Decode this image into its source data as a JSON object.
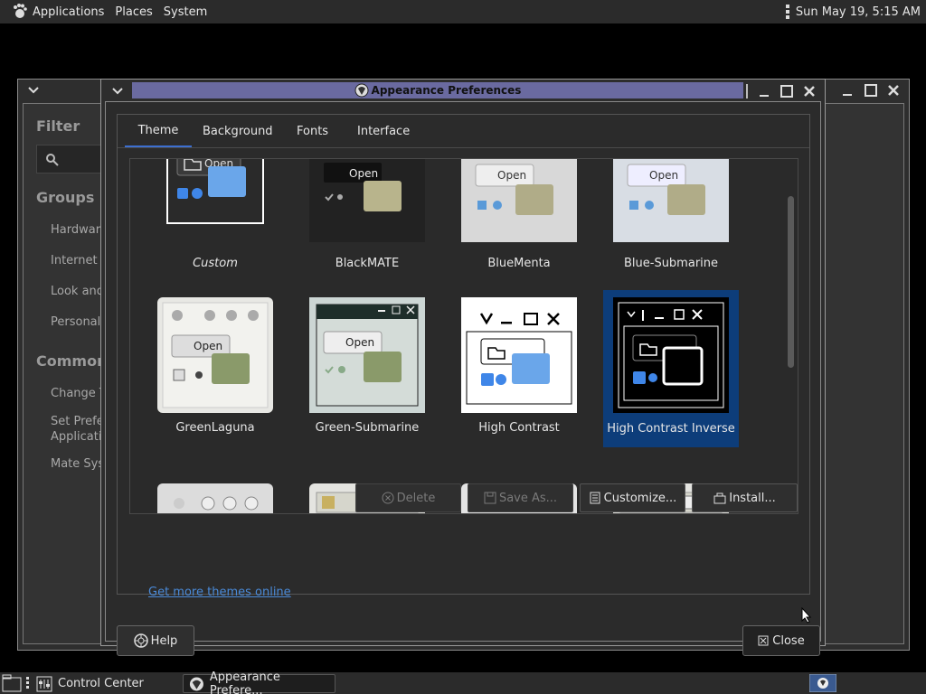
{
  "top_panel": {
    "menus": [
      "Applications",
      "Places",
      "System"
    ],
    "clock": "Sun May 19,  5:15 AM"
  },
  "control_center": {
    "filter_heading": "Filter",
    "groups_heading": "Groups",
    "groups": [
      "Hardware",
      "Internet a",
      "Look and",
      "Personal"
    ],
    "common_heading": "Common T",
    "common_items": [
      "Change T",
      "Set Prefe",
      "Applicatio",
      "Mate Syst"
    ]
  },
  "dialog": {
    "title": "Appearance Preferences",
    "tabs": [
      "Theme",
      "Background",
      "Fonts",
      "Interface"
    ],
    "active_tab": "Theme",
    "themes": [
      {
        "name": "Custom",
        "style": "italic"
      },
      {
        "name": "BlackMATE"
      },
      {
        "name": "BlueMenta"
      },
      {
        "name": "Blue-Submarine"
      },
      {
        "name": "GreenLaguna"
      },
      {
        "name": "Green-Submarine"
      },
      {
        "name": "High Contrast"
      },
      {
        "name": "High Contrast Inverse",
        "selected": true
      }
    ],
    "thumb_text": "Open",
    "buttons": {
      "delete": "Delete",
      "save_as": "Save As...",
      "customize": "Customize...",
      "install": "Install..."
    },
    "more_link": "Get more themes online",
    "help": "Help",
    "close": "Close"
  },
  "taskbar": {
    "items": [
      "Control Center",
      "Appearance Prefere..."
    ]
  },
  "colors": {
    "accent": "#3d6fd0",
    "selection": "#0d3d7a",
    "title_bar": "#6a6aa0",
    "link": "#4a8ad8"
  }
}
